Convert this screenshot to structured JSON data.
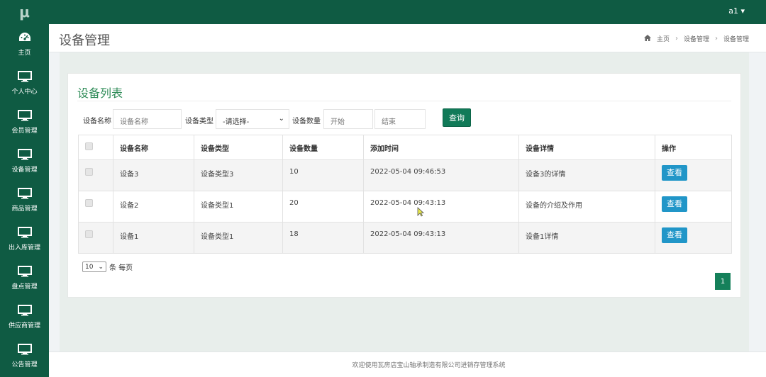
{
  "brand": {
    "logo_text": "μ"
  },
  "user": {
    "name": "a1",
    "caret": "▾"
  },
  "sidebar": {
    "items": [
      {
        "label": "主页",
        "icon": "dashboard-icon"
      },
      {
        "label": "个人中心",
        "icon": "monitor-icon"
      },
      {
        "label": "会员管理",
        "icon": "monitor-icon"
      },
      {
        "label": "设备管理",
        "icon": "monitor-icon"
      },
      {
        "label": "商品管理",
        "icon": "monitor-icon"
      },
      {
        "label": "出入库管理",
        "icon": "monitor-icon"
      },
      {
        "label": "盘点管理",
        "icon": "monitor-icon"
      },
      {
        "label": "供应商管理",
        "icon": "monitor-icon"
      },
      {
        "label": "公告管理",
        "icon": "monitor-icon"
      }
    ]
  },
  "header": {
    "title": "设备管理",
    "breadcrumb": [
      "主页",
      "设备管理",
      "设备管理"
    ]
  },
  "card": {
    "title": "设备列表"
  },
  "filters": {
    "name_label": "设备名称",
    "name_placeholder": "设备名称",
    "type_label": "设备类型",
    "type_selected": "-请选择-",
    "qty_label": "设备数量",
    "qty_start_placeholder": "开始",
    "qty_end_placeholder": "结束",
    "query_label": "查询"
  },
  "table": {
    "columns": [
      "设备名称",
      "设备类型",
      "设备数量",
      "添加时间",
      "设备详情",
      "操作"
    ],
    "rows": [
      {
        "name": "设备3",
        "type": "设备类型3",
        "qty": "10",
        "time": "2022-05-04 09:46:53",
        "detail": "设备3的详情",
        "action": "查看"
      },
      {
        "name": "设备2",
        "type": "设备类型1",
        "qty": "20",
        "time": "2022-05-04 09:43:13",
        "detail": "设备的介绍及作用",
        "action": "查看"
      },
      {
        "name": "设备1",
        "type": "设备类型1",
        "qty": "18",
        "time": "2022-05-04 09:43:13",
        "detail": "设备1详情",
        "action": "查看"
      }
    ]
  },
  "pagination": {
    "page_size": "10",
    "page_size_suffix": "条 每页",
    "current_page": "1"
  },
  "footer": {
    "text": "欢迎使用瓦房店宝山轴承制造有限公司进销存管理系统"
  },
  "colors": {
    "primary": "#0f5b43",
    "accent_green": "#2e8b57",
    "button_blue": "#2196c8"
  }
}
